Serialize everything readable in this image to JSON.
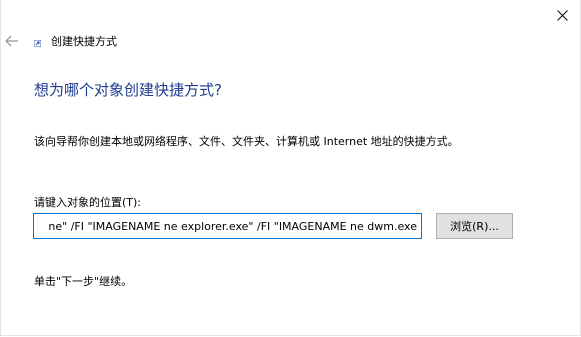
{
  "window": {
    "title": "创建快捷方式"
  },
  "main": {
    "heading": "想为哪个对象创建快捷方式?",
    "description": "该向导帮你创建本地或网络程序、文件、文件夹、计算机或 Internet 地址的快捷方式。",
    "location_label": "请键入对象的位置(T):",
    "location_value": "ne\" /FI \"IMAGENAME ne explorer.exe\" /FI \"IMAGENAME ne dwm.exe",
    "browse_label": "浏览(R)...",
    "footer_hint": "单击\"下一步\"继续。"
  },
  "icons": {
    "close": "close-icon",
    "back": "back-arrow-icon",
    "wizard": "shortcut-wizard-icon"
  },
  "colors": {
    "heading": "#1e3d8f",
    "input_focus_border": "#0078d7",
    "button_face": "#e1e1e1"
  }
}
